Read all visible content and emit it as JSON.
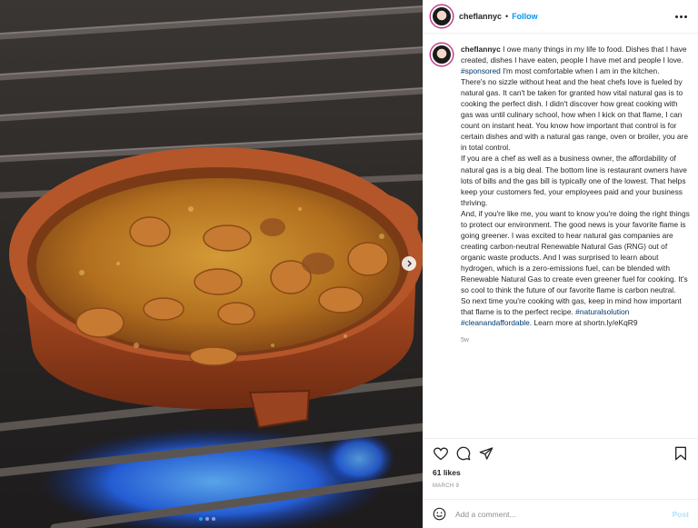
{
  "post": {
    "username": "cheflannyc",
    "follow_label": "Follow",
    "separator": "•",
    "icons": {
      "more": "more-options-icon",
      "next": "chevron-right-icon",
      "like": "heart-icon",
      "comment": "comment-icon",
      "share": "paper-plane-icon",
      "save": "bookmark-icon",
      "emoji": "smiley-icon"
    },
    "image": {
      "description_icon": "photo-of-clay-dish-on-gas-stove",
      "carousel_count": 3,
      "carousel_active": 1
    }
  },
  "caption": {
    "p1_pre": "I owe many things in my life to food. Dishes that I have created, dishes I have eaten, people I have met and people I love. ",
    "p1_tag": "#sponsored",
    "p1_post": " I'm most comfortable when I am in the kitchen.",
    "p2": "There's no sizzle without heat and the heat chefs love is fueled by natural gas. It can't be taken for granted how vital natural gas is to cooking the perfect dish. I didn't discover how great cooking with gas was until culinary school, how when I kick on that flame, I can count on instant heat. You know how important that control is for certain dishes and with a natural gas range, oven or broiler, you are in total control.",
    "p3": "If you are a chef as well as a business owner, the affordability of natural gas is a big deal. The bottom line is restaurant owners have lots of bills and the gas bill is typically one of the lowest. That helps keep your customers fed, your employees paid and your business thriving.",
    "p4": "And, if you're like me, you want to know you're doing the right things to protect our environment. The good news is your favorite flame is going greener. I was excited to hear natural gas companies are creating carbon-neutral Renewable Natural Gas (RNG) out of organic waste products. And I was surprised to learn about hydrogen, which is a zero-emissions fuel, can be blended with Renewable Natural Gas to create even greener fuel for cooking. It's so cool to think the future of our favorite flame is carbon neutral.",
    "p5_pre": "So next time you're cooking with gas, keep in mind how important that flame is to the perfect recipe. ",
    "p5_tag1": "#naturalsolution",
    "p5_tag2": "#cleanandaffordable",
    "p5_post": ". Learn more at shortn.ly/eKqR9",
    "age": "5w"
  },
  "stats": {
    "likes": "61 likes",
    "date": "MARCH 9"
  },
  "comment": {
    "placeholder": "Add a comment...",
    "post_label": "Post"
  },
  "colors": {
    "link_blue": "#0095f6",
    "hashtag": "#00376b",
    "post_disabled": "#b2dffc",
    "carousel_active": "#1da1f2"
  }
}
